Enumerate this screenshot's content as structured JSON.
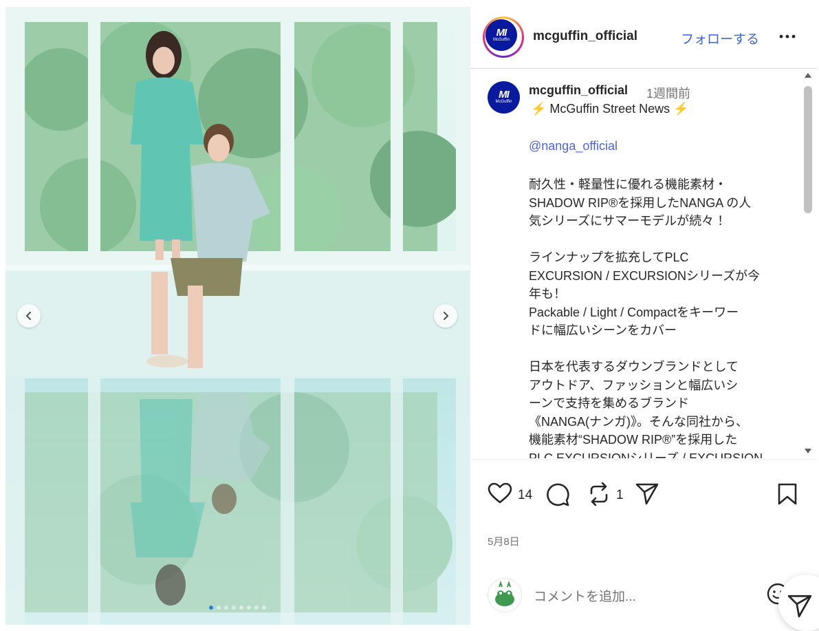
{
  "header": {
    "username": "mcguffin_official",
    "follow_label": "フォローする",
    "more_icon": "more-horizontal-icon"
  },
  "brand": {
    "logo_mark": "MI",
    "logo_sub": "McGuffin",
    "logo_color": "#0a1a9e"
  },
  "media": {
    "prev_icon": "chevron-left-icon",
    "next_icon": "chevron-right-icon",
    "slide_count": 8,
    "active_slide": 0
  },
  "caption": {
    "username": "mcguffin_official",
    "time": "1週間前",
    "bolt": "⚡",
    "headline": " McGuffin Street News ",
    "mention": "@nanga_official",
    "body": "耐久性・軽量性に優れる機能素材・\nSHADOW RIP®を採用したNANGA の人\n気シリーズにサマーモデルが続々 ！\n\nラインナップを拡充してPLC\nEXCURSION / EXCURSIONシリーズが今\n年も！\nPackable / Light / Compactをキーワー\nドに幅広いシーンをカバー\n\n日本を代表するダウンブランドとして\nアウトドア、ファッションと幅広いシ\nーンで支持を集めるブランド\n《NANGA(ナンガ)》。そんな同社から、\n機能素材“SHADOW RIP®”を採用した\nPLC EXCURSIONシリーズ / EXCURSION"
  },
  "actions": {
    "like_count": "14",
    "repost_count": "1"
  },
  "post_date": "5月8日",
  "comment": {
    "placeholder": "コメントを追加..."
  },
  "colors": {
    "link": "#3a65d8",
    "mention": "#4f63d8",
    "muted": "#737373"
  }
}
